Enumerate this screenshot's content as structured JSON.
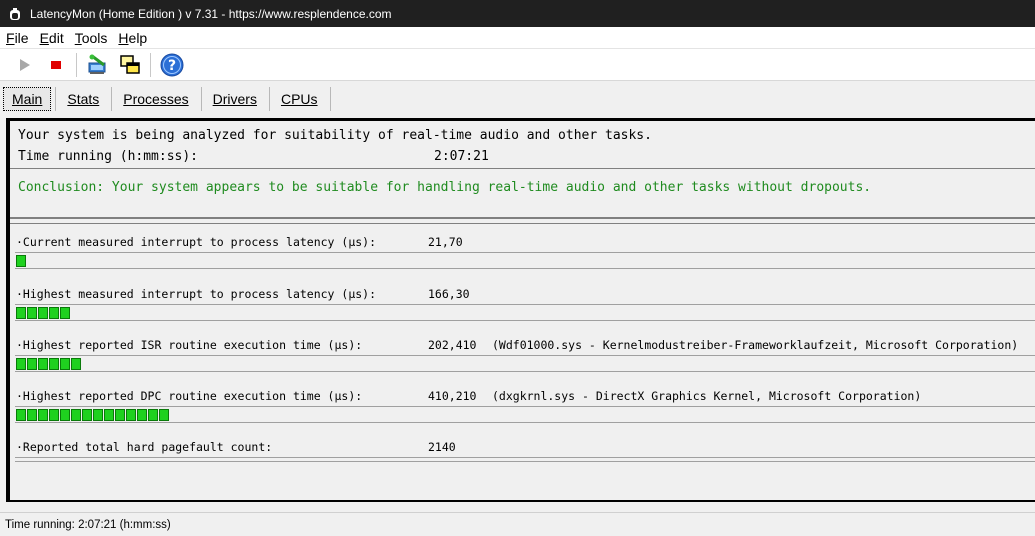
{
  "window": {
    "title": "LatencyMon  (Home Edition )  v 7.31 - https://www.resplendence.com"
  },
  "menu": [
    {
      "label": "File",
      "accel": "F",
      "rest": "ile"
    },
    {
      "label": "Edit",
      "accel": "E",
      "rest": "dit"
    },
    {
      "label": "Tools",
      "accel": "T",
      "rest": "ools"
    },
    {
      "label": "Help",
      "accel": "H",
      "rest": "elp"
    }
  ],
  "toolbar": {
    "icons": [
      "play-icon",
      "stop-icon",
      "analyze-icon",
      "windows-icon",
      "help-icon"
    ]
  },
  "tabs": [
    {
      "label": "Main",
      "active": true
    },
    {
      "label": "Stats"
    },
    {
      "label": "Processes"
    },
    {
      "label": "Drivers"
    },
    {
      "label": "CPUs"
    }
  ],
  "main": {
    "line1": "Your system is being analyzed for suitability of real-time audio and other tasks.",
    "time_label": "Time running (h:mm:ss):",
    "time_value": "2:07:21",
    "conclusion": "Conclusion: Your system appears to be suitable for handling real-time audio and other tasks without dropouts."
  },
  "metrics": [
    {
      "label": "·Current measured interrupt to process latency (µs):",
      "value": "21,70",
      "extra": "",
      "bar_segments": 1
    },
    {
      "label": "·Highest measured interrupt to process latency (µs):",
      "value": "166,30",
      "extra": "",
      "bar_segments": 5
    },
    {
      "label": "·Highest reported ISR routine execution time (µs):",
      "value": "202,410",
      "extra": "(Wdf01000.sys - Kernelmodustreiber-Frameworklaufzeit, Microsoft Corporation)",
      "bar_segments": 6
    },
    {
      "label": "·Highest reported DPC routine execution time (µs):",
      "value": "410,210",
      "extra": "(dxgkrnl.sys - DirectX Graphics Kernel, Microsoft Corporation)",
      "bar_segments": 14
    },
    {
      "label": "·Reported total hard pagefault count:",
      "value": "2140",
      "extra": "",
      "bar_segments": 0
    }
  ],
  "colors": {
    "conclusion": "#1f8b1f",
    "bar_fill": "#1fd11f",
    "titlebar": "#202020"
  },
  "status": {
    "text": "Time running: 2:07:21  (h:mm:ss)"
  }
}
